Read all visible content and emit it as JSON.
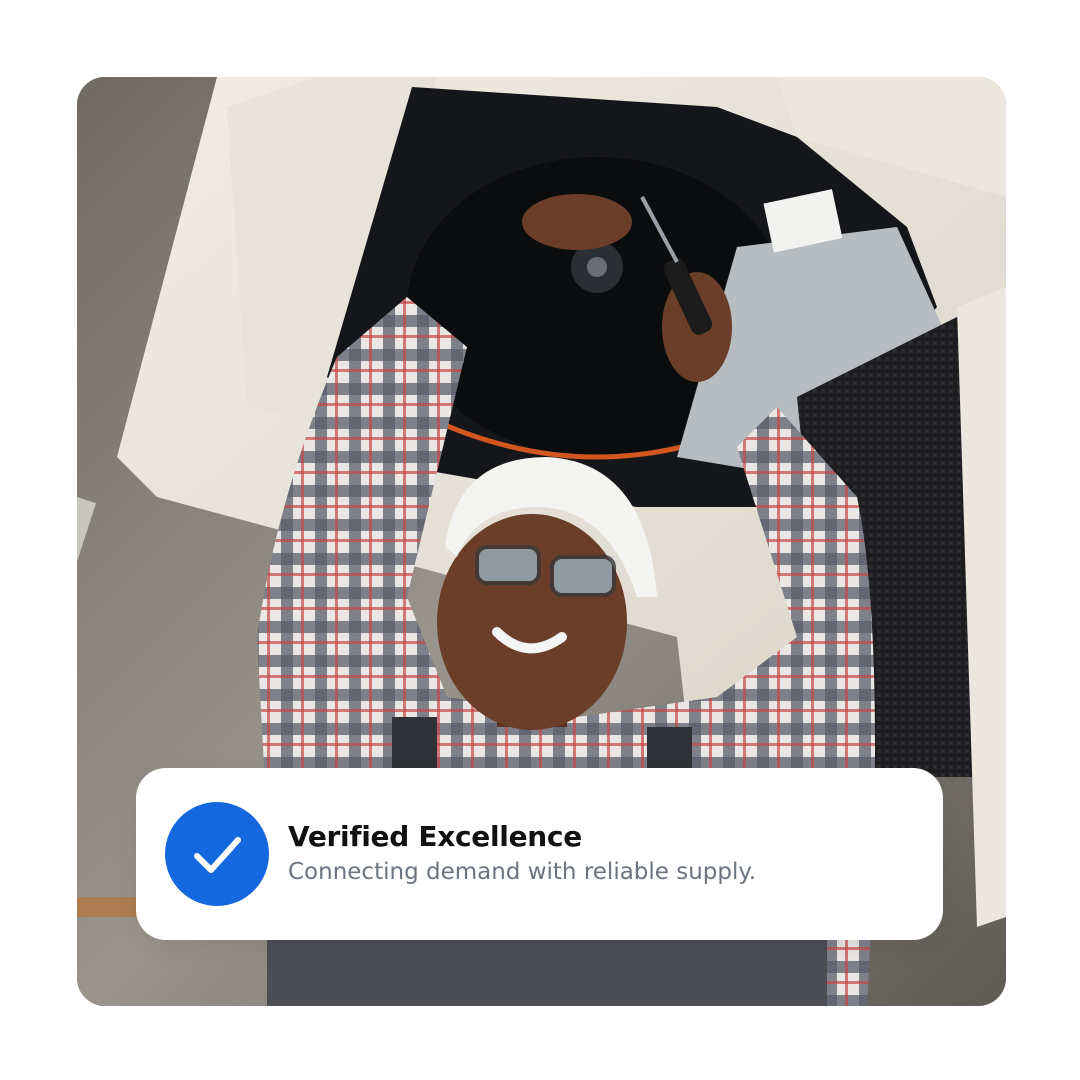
{
  "photo": {
    "subject": "technician-servicing-ceiling-ac-unit"
  },
  "badge": {
    "icon": "checkmark-icon",
    "icon_color": "#1368e0",
    "title": "Verified Excellence",
    "subtitle": "Connecting demand with reliable supply."
  }
}
